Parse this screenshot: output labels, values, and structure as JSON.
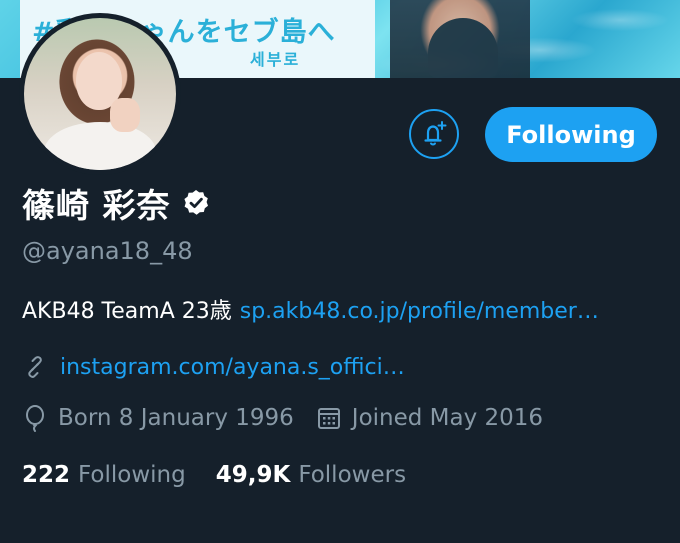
{
  "banner": {
    "headline": "#彩奈ちゃんをセブ島へ",
    "subtitle": "세부로"
  },
  "actions": {
    "follow_label": "Following",
    "bell_icon": "bell-plus-icon"
  },
  "profile": {
    "display_name": "篠崎 彩奈",
    "handle": "@ayana18_48",
    "bio_text": "AKB48 TeamA 23歳",
    "bio_link": "sp.akb48.co.jp/profile/member…",
    "website": "instagram.com/ayana.s_offici…",
    "birth": "Born 8 January 1996",
    "joined": "Joined May 2016"
  },
  "stats": {
    "following_count": "222",
    "following_label": "Following",
    "followers_count": "49,9K",
    "followers_label": "Followers"
  },
  "colors": {
    "background": "#15202b",
    "accent": "#1da1f2",
    "secondary_text": "#8899a6"
  }
}
